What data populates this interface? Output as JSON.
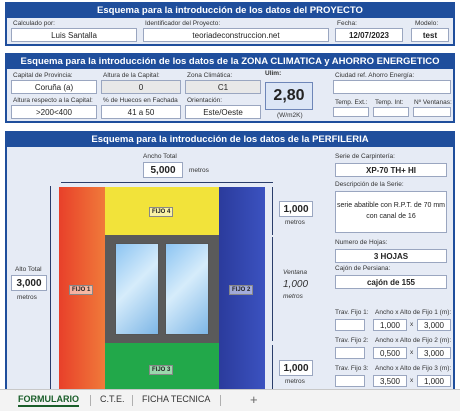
{
  "proyecto": {
    "title": "Esquema para la introducción de los datos del PROYECTO",
    "calculado_label": "Calculado por:",
    "calculado_value": "Luis Santalla",
    "identificador_label": "Identificador del Proyecto:",
    "identificador_value": "teoriadeconstruccion.net",
    "fecha_label": "Fecha:",
    "fecha_value": "12/07/2023",
    "modelo_label": "Modelo:",
    "modelo_value": "test"
  },
  "zona": {
    "title": "Esquema para la introducción de los datos de la ZONA CLIMATICA y AHORRO ENERGETICO",
    "capital_label": "Capital de Provincia:",
    "capital_value": "Coruña (a)",
    "altura_capital_label": "Altura de la Capital:",
    "altura_capital_value": "0",
    "zona_label": "Zona Climática:",
    "zona_value": "C1",
    "ulim_label": "Ulim:",
    "ulim_value": "2,80",
    "ulim_unit": "(W/m2K)",
    "ciudad_label": "Ciudad ref. Ahorro Energía:",
    "ciudad_value": "",
    "altura_rel_label": "Altura respecto a la Capital:",
    "altura_rel_value": ">200<400",
    "huecos_label": "% de Huecos en Fachada",
    "huecos_value": "41 a 50",
    "orientacion_label": "Orientación:",
    "orientacion_value": "Este/Oeste",
    "temp_ext_label": "Temp. Ext.:",
    "temp_int_label": "Temp. Int:",
    "ventanas_label": "Nº Ventanas:"
  },
  "perfileria": {
    "title": "Esquema para la introducción de los datos de la PERFILERIA",
    "ancho_total_label": "Ancho Total",
    "ancho_total_value": "5,000",
    "ancho_unit": "metros",
    "alto_total_label": "Alto Total",
    "alto_total_value": "3,000",
    "alto_unit": "metros",
    "fijo4_value": "1,000",
    "fijo4_unit": "metros",
    "ventana_label": "Ventana",
    "ventana_value": "1,000",
    "ventana_unit": "metros",
    "fijo3_value": "1,000",
    "fijo3_unit": "metros",
    "zones": {
      "fijo1": "FIJO 1",
      "fijo2": "FIJO 2",
      "fijo3": "FIJO 3",
      "fijo4": "FIJO 4"
    },
    "serie_label": "Serie de Carpintería:",
    "serie_value": "XP-70 TH+ HI",
    "descripcion_label": "Descripción de la Serie:",
    "descripcion_line1": "serie abatible con R.P.T. de 70 mm",
    "descripcion_line2": "con canal de 16",
    "hojas_label": "Numero de Hojas:",
    "hojas_value": "3 HOJAS",
    "cajon_label": "Cajón de Persiana:",
    "cajon_value": "cajón de 155",
    "trav_fijo1_label": "Trav. Fijo 1:",
    "trav_fijo2_label": "Trav. Fijo 2:",
    "trav_fijo3_label": "Trav. Fijo 3:",
    "axa1_label": "Ancho x Alto de Fijo 1 (m):",
    "axa1_ancho": "1,000",
    "axa1_alto": "3,000",
    "axa2_label": "Ancho x Alto de Fijo 2 (m):",
    "axa2_ancho": "0,500",
    "axa2_alto": "3,000",
    "axa3_label": "Ancho x Alto de Fijo 3 (m):",
    "axa3_ancho": "3,500",
    "axa3_alto": "1,000",
    "times": "x"
  },
  "tabs": [
    {
      "label": "FORMULARIO"
    },
    {
      "label": "C.T.E."
    },
    {
      "label": "FICHA TECNICA"
    }
  ],
  "add_tab": "+",
  "colors": {
    "header_blue": "#1f4e9c",
    "fijo1_red": "#e04a2f",
    "fijo2_blue": "#2a3fa8",
    "fijo3_green": "#22a84a",
    "fijo4_yellow": "#f2e33a"
  }
}
